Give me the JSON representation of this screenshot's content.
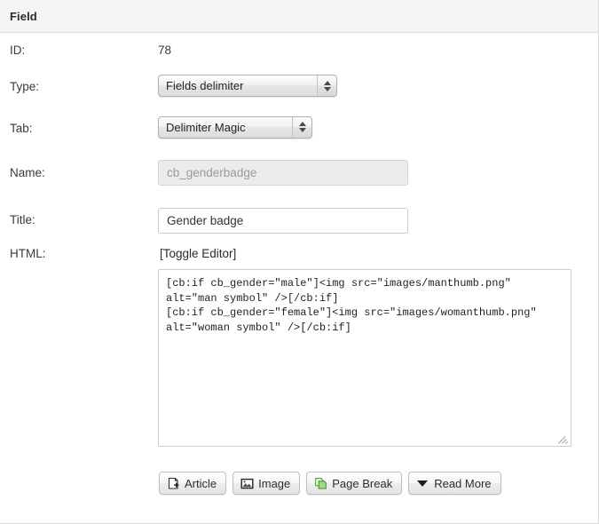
{
  "panel": {
    "header_title": "Field"
  },
  "fields": {
    "id": {
      "label": "ID:",
      "value": "78"
    },
    "type": {
      "label": "Type:",
      "selected": "Fields delimiter"
    },
    "tab": {
      "label": "Tab:",
      "selected": "Delimiter Magic"
    },
    "name": {
      "label": "Name:",
      "value": "cb_genderbadge",
      "placeholder": "cb_genderbadge"
    },
    "title": {
      "label": "Title:",
      "value": "Gender badge",
      "placeholder": ""
    },
    "html": {
      "label": "HTML:",
      "toggle_editor_label": "[Toggle Editor]",
      "content": "[cb:if cb_gender=\"male\"]<img src=\"images/manthumb.png\" alt=\"man symbol\" />[/cb:if]\n[cb:if cb_gender=\"female\"]<img src=\"images/womanthumb.png\" alt=\"woman symbol\" />[/cb:if]"
    }
  },
  "editor_buttons": [
    {
      "label": "Article",
      "icon": "article-page-add-icon"
    },
    {
      "label": "Image",
      "icon": "image-picture-icon"
    },
    {
      "label": "Page Break",
      "icon": "page-break-pages-icon"
    },
    {
      "label": "Read More",
      "icon": "read-more-chevron-down-icon"
    }
  ],
  "colors": {
    "header_bg": "#f4f4f4",
    "panel_border": "#dddddd",
    "disabled_bg": "#ebebeb",
    "disabled_text": "#9a9a9a",
    "accent_green": "#6ab04c",
    "text": "#333333"
  }
}
